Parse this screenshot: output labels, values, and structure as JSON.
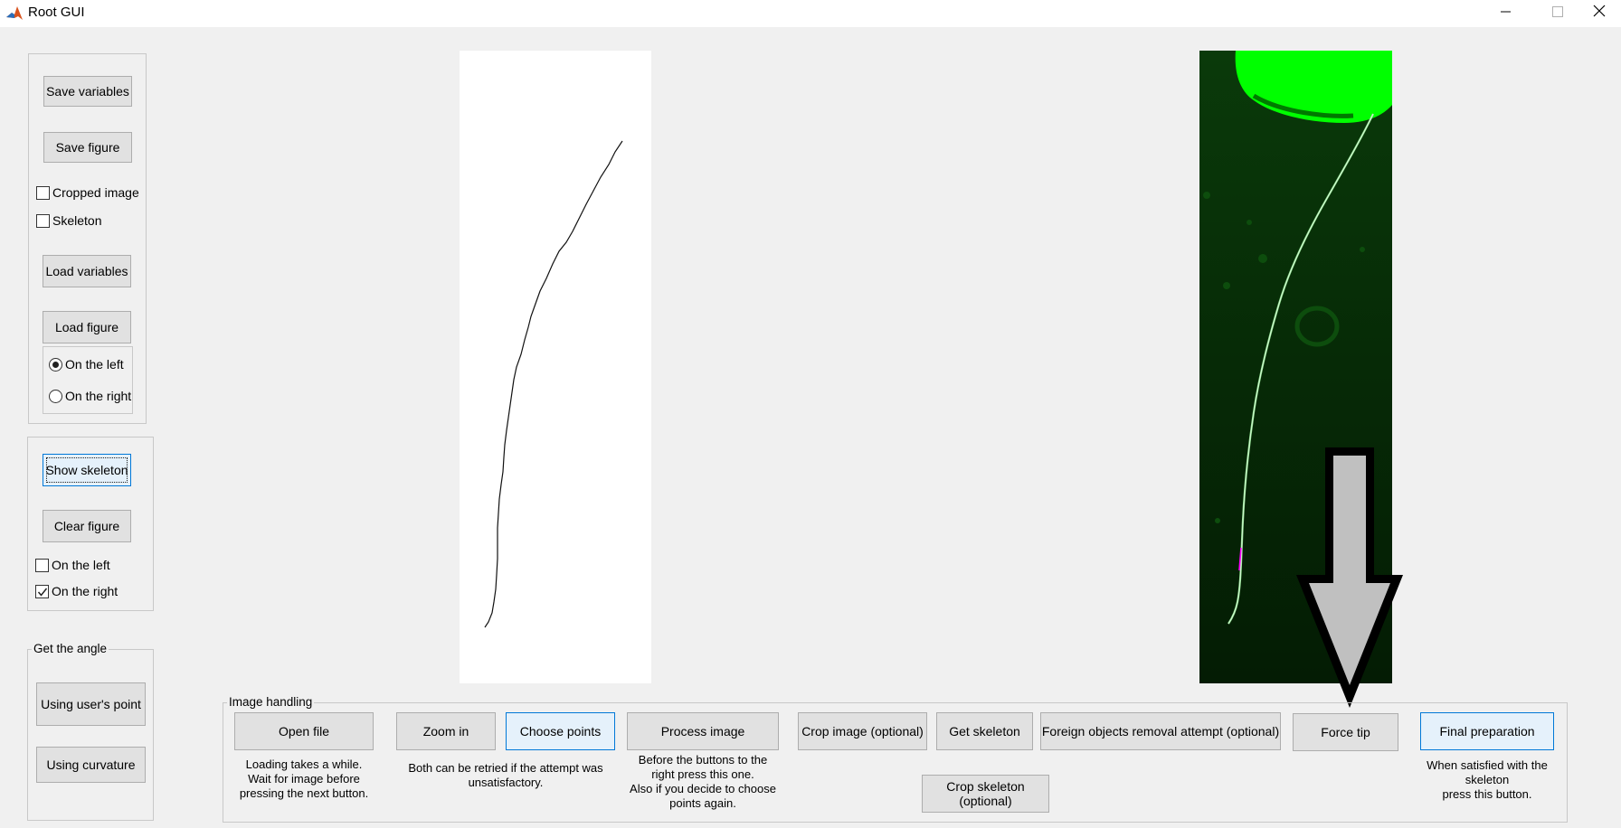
{
  "window": {
    "title": "Root GUI"
  },
  "save_panel": {
    "save_variables": "Save variables",
    "save_figure": "Save figure",
    "checkboxes": [
      {
        "label": "Cropped image",
        "checked": false
      },
      {
        "label": "Skeleton",
        "checked": false
      }
    ],
    "load_variables": "Load variables",
    "load_figure": "Load figure",
    "radios": [
      {
        "label": "On the left",
        "selected": true
      },
      {
        "label": "On the right",
        "selected": false
      }
    ]
  },
  "skeleton_panel": {
    "show_skeleton": "Show skeleton",
    "clear_figure": "Clear figure",
    "checkboxes": [
      {
        "label": "On the left",
        "checked": false
      },
      {
        "label": "On the right",
        "checked": true
      }
    ]
  },
  "angle_panel": {
    "title": "Get the angle",
    "using_users_point": "Using user's point",
    "using_curvature": "Using curvature"
  },
  "image_panel": {
    "title": "Image handling",
    "buttons": {
      "open_file": "Open file",
      "zoom_in": "Zoom in",
      "choose_points": "Choose points",
      "process_image": "Process image",
      "crop_image": "Crop image (optional)",
      "get_skeleton": "Get skeleton",
      "foreign_objects": "Foreign objects removal attempt (optional)",
      "force_tip": "Force tip",
      "final_preparation": "Final preparation",
      "crop_skeleton": "Crop skeleton (optional)"
    },
    "help": {
      "open_file": [
        "Loading takes a while.",
        "Wait for  image before",
        "pressing the next button."
      ],
      "zoom_choose": [
        "Both can be retried if the attempt was",
        "unsatisfactory."
      ],
      "process": [
        "Before the buttons to the",
        "right press this one.",
        "Also if you decide to choose",
        "points again."
      ],
      "final": [
        "When satisfied with the",
        "skeleton",
        "press this button."
      ]
    }
  },
  "colors": {
    "window_bg": "#f0f0f0",
    "button_bg": "#e1e1e1",
    "accent_border": "#0078d7",
    "accent_bg": "#e5f1fb",
    "fluorescent_green": "#00ff00",
    "image_bg": "#062806",
    "arrow_fill": "#c0c0c0"
  },
  "icons": {
    "app": "matlab-logo-icon",
    "minimize": "minimize-icon",
    "maximize": "maximize-icon",
    "close": "close-icon",
    "arrow": "down-arrow-icon"
  }
}
